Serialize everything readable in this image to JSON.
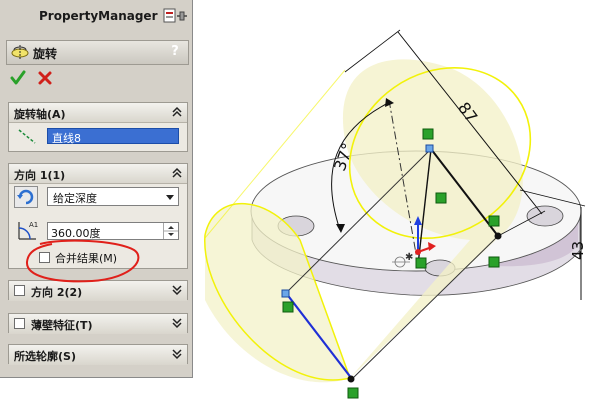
{
  "panel": {
    "title": "PropertyManager",
    "feature_name": "旋转",
    "help": "?"
  },
  "sections": {
    "axis": {
      "title": "旋转轴(A)",
      "value": "直线8"
    },
    "direction1": {
      "title": "方向 1(1)",
      "end_condition": "给定深度",
      "angle": "360.00度",
      "merge_label": "合并结果(M)"
    },
    "direction2": {
      "title": "方向 2(2)"
    },
    "thin_feature": {
      "title": "薄壁特征(T)"
    },
    "selected_contours": {
      "title": "所选轮廓(S)"
    }
  },
  "graphics": {
    "dim_angle": "37°",
    "dim_length": "87",
    "dim_height": "43"
  },
  "colors": {
    "preview_fill": "#f3f1c8",
    "preview_outline": "#f2f20a",
    "sketch_line": "#1f2fd6",
    "accept_green": "#2aa12a",
    "cancel_red": "#d0201a",
    "annotation_red": "#e0201a"
  }
}
